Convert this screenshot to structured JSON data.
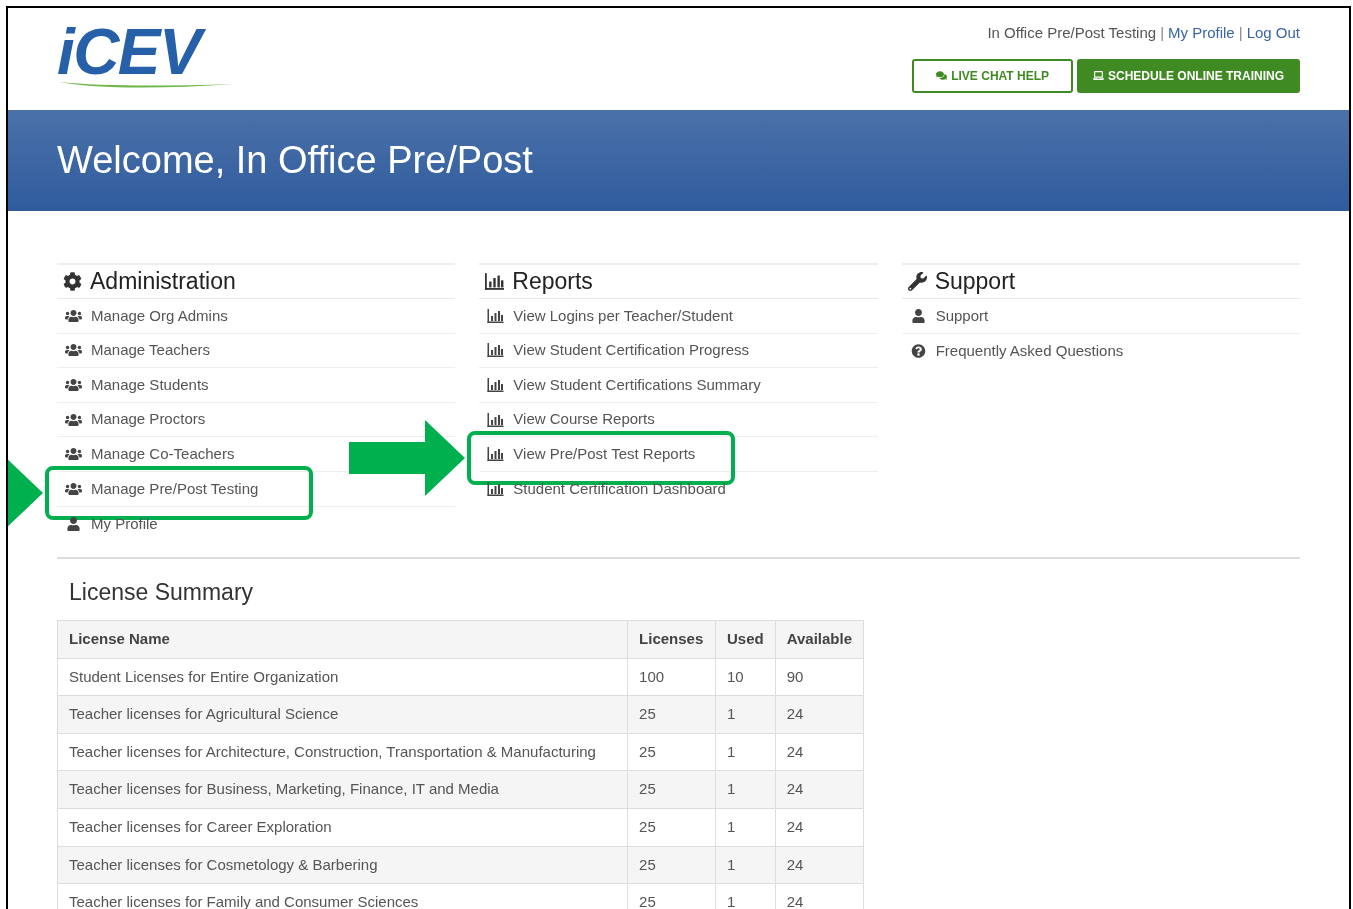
{
  "header": {
    "logo": "iCEV",
    "user_links": [
      {
        "label": "In Office Pre/Post Testing",
        "kind": "text"
      },
      {
        "label": "|",
        "kind": "separator"
      },
      {
        "label": "My Profile",
        "kind": "link"
      },
      {
        "label": "|",
        "kind": "separator"
      },
      {
        "label": "Log Out",
        "kind": "link"
      }
    ],
    "buttons": [
      {
        "label": "LIVE CHAT HELP",
        "kind": "outline"
      },
      {
        "label": "SCHEDULE ONLINE TRAINING",
        "kind": "solid"
      }
    ]
  },
  "banner": {
    "title": "Welcome, In Office Pre/Post"
  },
  "sections": [
    {
      "title": "Administration",
      "items": [
        {
          "label": "Manage Org Admins",
          "kind": "users",
          "highlighted": false
        },
        {
          "label": "Manage Teachers",
          "kind": "users",
          "highlighted": false
        },
        {
          "label": "Manage Students",
          "kind": "users",
          "highlighted": false
        },
        {
          "label": "Manage Proctors",
          "kind": "users",
          "highlighted": false
        },
        {
          "label": "Manage Co-Teachers",
          "kind": "users",
          "highlighted": false
        },
        {
          "label": "Manage Pre/Post Testing",
          "kind": "users",
          "highlighted": true
        },
        {
          "label": "My Profile",
          "kind": "user",
          "highlighted": false
        }
      ]
    },
    {
      "title": "Reports",
      "items": [
        {
          "label": "View Logins per Teacher/Student",
          "kind": "chart",
          "highlighted": false
        },
        {
          "label": "View Student Certification Progress",
          "kind": "chart",
          "highlighted": false
        },
        {
          "label": "View Student Certifications Summary",
          "kind": "chart",
          "highlighted": false
        },
        {
          "label": "View Course Reports",
          "kind": "chart",
          "highlighted": false
        },
        {
          "label": "View Pre/Post Test Reports",
          "kind": "chart",
          "highlighted": true
        },
        {
          "label": "Student Certification Dashboard",
          "kind": "chart",
          "highlighted": false
        }
      ]
    },
    {
      "title": "Support",
      "items": [
        {
          "label": "Support",
          "kind": "user",
          "highlighted": false
        },
        {
          "label": "Frequently Asked Questions",
          "kind": "question",
          "highlighted": false
        }
      ]
    }
  ],
  "license_summary": {
    "title": "License Summary",
    "columns": [
      "License Name",
      "Licenses",
      "Used",
      "Available"
    ],
    "rows": [
      [
        "Student Licenses for Entire Organization",
        "100",
        "10",
        "90"
      ],
      [
        "Teacher licenses for Agricultural Science",
        "25",
        "1",
        "24"
      ],
      [
        "Teacher licenses for Architecture, Construction, Transportation & Manufacturing",
        "25",
        "1",
        "24"
      ],
      [
        "Teacher licenses for Business, Marketing, Finance, IT and Media",
        "25",
        "1",
        "24"
      ],
      [
        "Teacher licenses for Career Exploration",
        "25",
        "1",
        "24"
      ],
      [
        "Teacher licenses for Cosmetology & Barbering",
        "25",
        "1",
        "24"
      ],
      [
        "Teacher licenses for Family and Consumer Sciences",
        "25",
        "1",
        "24"
      ]
    ]
  }
}
